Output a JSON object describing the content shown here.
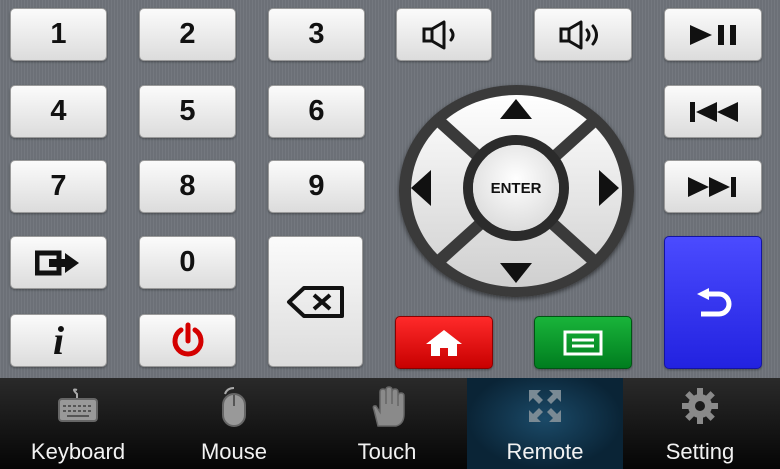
{
  "keypad": {
    "digits": [
      "1",
      "2",
      "3",
      "4",
      "5",
      "6",
      "7",
      "8",
      "9",
      "0"
    ],
    "enter_label": "ENTER",
    "info_label": "i"
  },
  "nav": {
    "items": [
      {
        "label": "Keyboard",
        "icon": "keyboard-icon"
      },
      {
        "label": "Mouse",
        "icon": "mouse-icon"
      },
      {
        "label": "Touch",
        "icon": "hand-icon"
      },
      {
        "label": "Remote",
        "icon": "expand-icon",
        "active": true
      },
      {
        "label": "Setting",
        "icon": "gear-icon"
      }
    ]
  },
  "colors": {
    "power": "#d40000",
    "home": "#e00000",
    "menu": "#009a28",
    "back": "#3030f0",
    "nav_active": "#1b4a68"
  }
}
